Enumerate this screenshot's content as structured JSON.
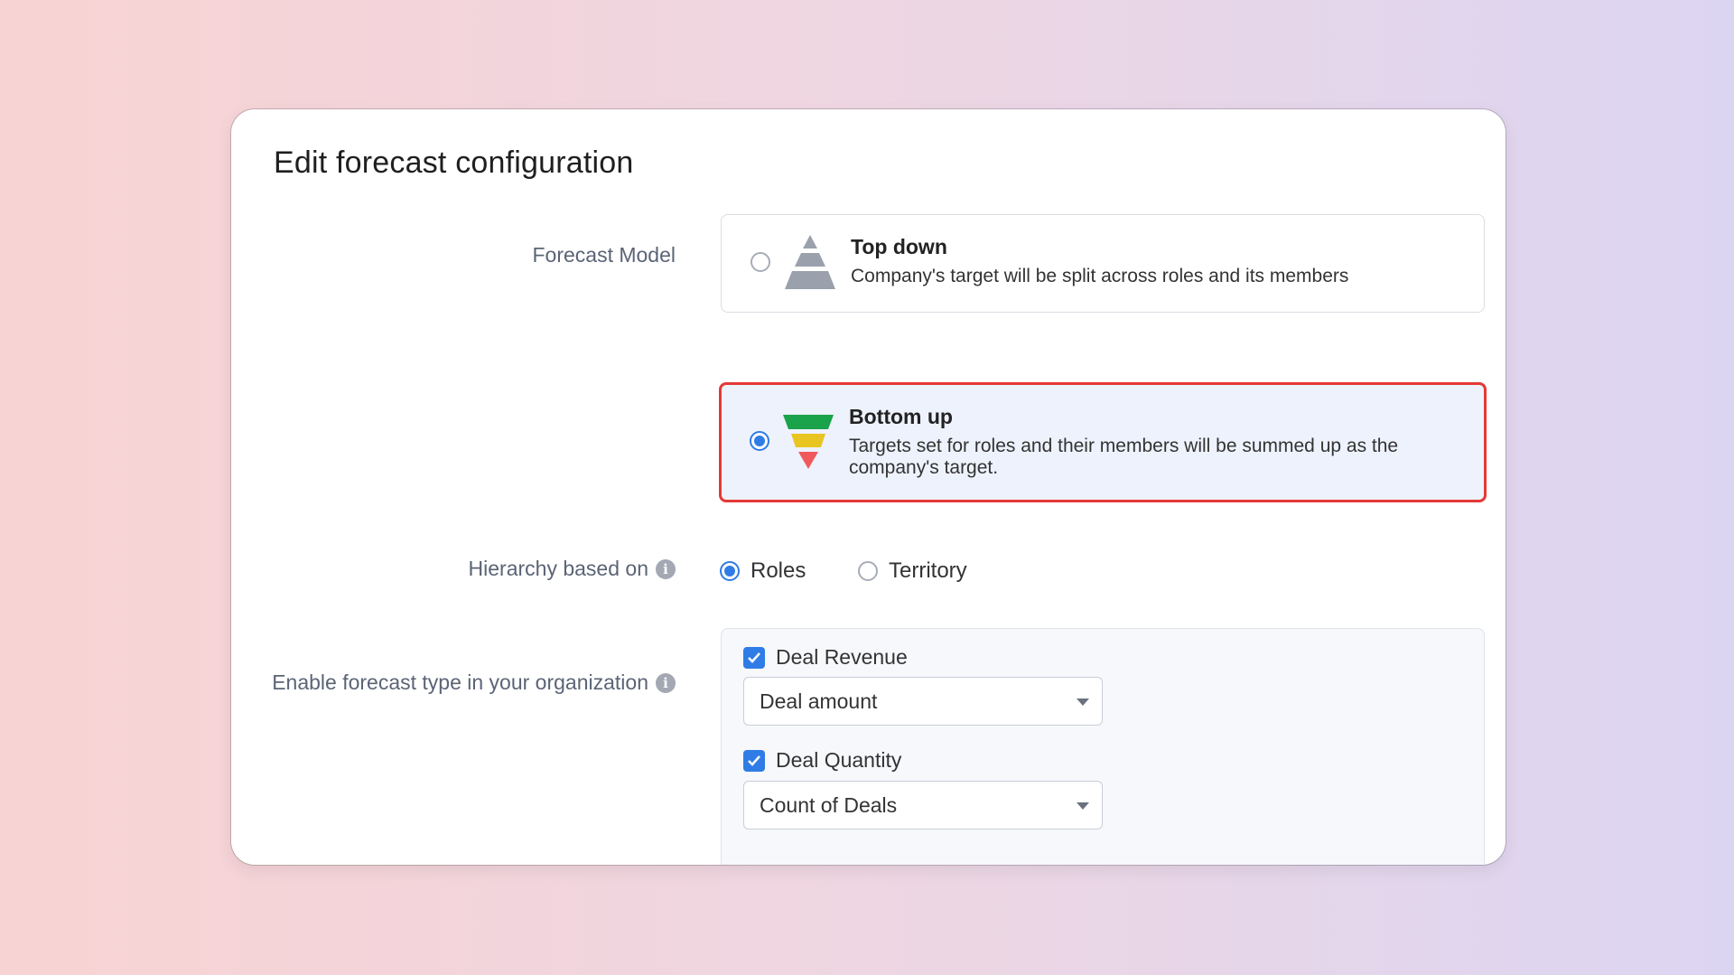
{
  "dialog": {
    "title": "Edit forecast configuration"
  },
  "forecast_model": {
    "label": "Forecast Model",
    "options": [
      {
        "title": "Top down",
        "description": "Company's target will be split across roles and its members",
        "selected": false,
        "icon": "pyramid-icon"
      },
      {
        "title": "Bottom up",
        "description": "Targets set for roles and their members will be summed up as the company's target.",
        "selected": true,
        "icon": "inverted-funnel-icon"
      }
    ]
  },
  "hierarchy": {
    "label": "Hierarchy based on",
    "options": [
      {
        "label": "Roles",
        "selected": true
      },
      {
        "label": "Territory",
        "selected": false
      }
    ]
  },
  "forecast_types": {
    "label": "Enable forecast type in your organization",
    "items": [
      {
        "label": "Deal Revenue",
        "checked": true,
        "select_value": "Deal amount"
      },
      {
        "label": "Deal Quantity",
        "checked": true,
        "select_value": "Count of Deals"
      }
    ]
  },
  "colors": {
    "accent": "#2f7ce6",
    "highlight_border": "#e53935",
    "selected_bg": "#eef2fc",
    "funnel_green": "#1aa34a",
    "funnel_yellow": "#e8c520",
    "funnel_red": "#f05a5a",
    "pyramid_gray": "#9aa1ad"
  }
}
